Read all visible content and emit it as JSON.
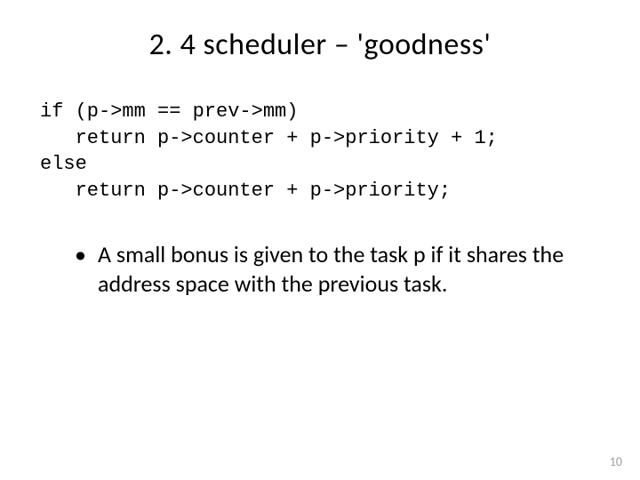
{
  "title": "2. 4 scheduler – 'goodness'",
  "code": {
    "line1": "if (p->mm == prev->mm)",
    "line2": "   return p->counter + p->priority + 1;",
    "line3": "else",
    "line4": "   return p->counter + p->priority;"
  },
  "bullet": {
    "mark": "•",
    "text": "A small bonus is given to the task p if it shares the address space with the previous task."
  },
  "page_number": "10"
}
